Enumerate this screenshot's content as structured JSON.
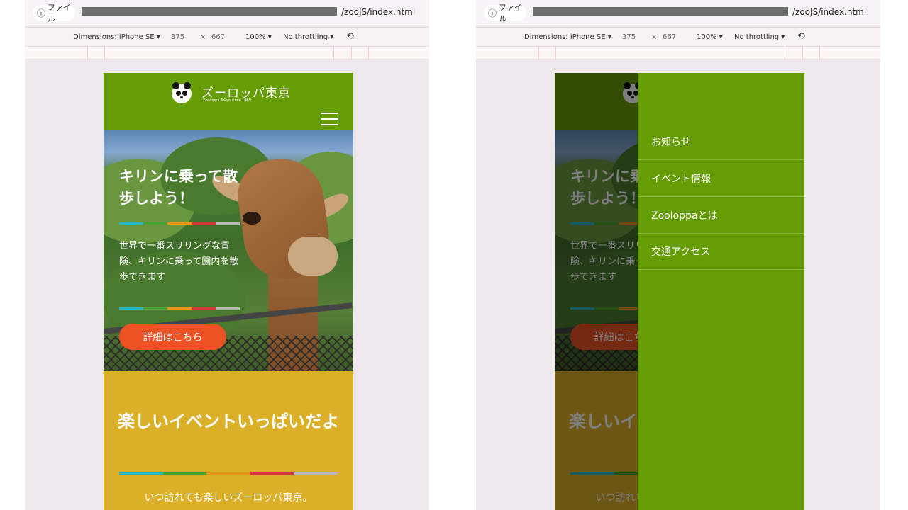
{
  "browser": {
    "info_label": "ファイル",
    "url_tail": "/zooJS/index.html"
  },
  "devtools": {
    "dimensions_label": "Dimensions: iPhone SE ▾",
    "width": "375",
    "times": "×",
    "height": "667",
    "zoom": "100% ▾",
    "throttle": "No throttling ▾"
  },
  "site": {
    "logo_name": "ズーロッパ東京",
    "logo_sub": "Zooloppa Tokyo since 1969",
    "hero_title": "キリンに乗って散歩しよう！",
    "hero_text": "世界で一番スリリングな冒険、キリンに乗って園内を散歩できます",
    "hero_button": "詳細はこちら",
    "event_title": "楽しいイベントいっぱいだよ",
    "event_text": "いつ訪れても楽しいズーロッパ東京。"
  },
  "menu": {
    "items": [
      "お知らせ",
      "イベント情報",
      "Zooloppaとは",
      "交通アクセス"
    ]
  },
  "colors": {
    "header_green": "#669c04",
    "button_orange": "#ed5224",
    "event_yellow": "#dcaf28",
    "stripe": [
      "#26b6c4",
      "#4aa232",
      "#e5951c",
      "#d6373a",
      "#b8b8b8"
    ]
  }
}
